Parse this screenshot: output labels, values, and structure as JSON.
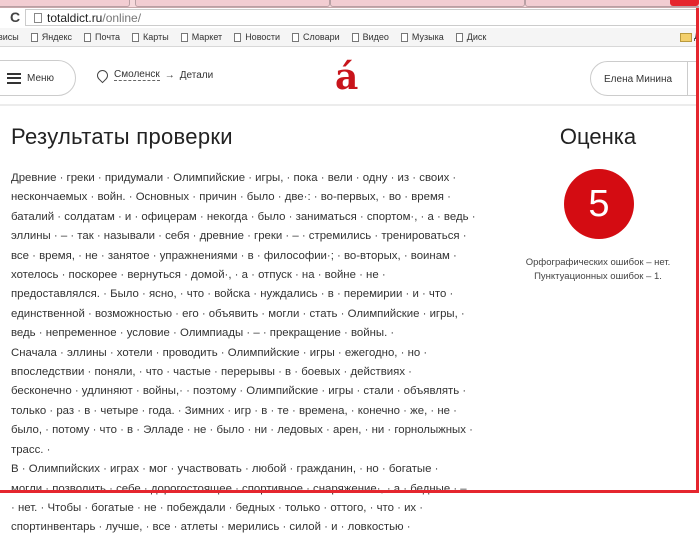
{
  "browser": {
    "url_host": "totaldict.ru",
    "url_path": "/online/",
    "bookmarks": [
      "висы",
      "Яндекс",
      "Почта",
      "Карты",
      "Маркет",
      "Новости",
      "Словари",
      "Видео",
      "Музыка",
      "Диск"
    ],
    "bookmark_folder": "Д"
  },
  "header": {
    "menu_label": "Меню",
    "city": "Смоленск",
    "arrow": "→",
    "section": "Детали",
    "logo": "á",
    "user": "Елена Минина"
  },
  "main": {
    "title": "Результаты проверки",
    "lines": [
      "Древние · греки · придумали · Олимпийские · игры, · пока · вели · одну · из · своих ·",
      "нескончаемых · войн. · Основных · причин · было · две·: · во-первых, · во · время ·",
      "баталий · солдатам · и · офицерам · некогда · было · заниматься · спортом·, · а · ведь ·",
      "эллины · – · так · называли · себя · древние · греки · – · стремились · тренироваться ·",
      "все · время, · не · занятое · упражнениями · в · философии·; · во-вторых, · воинам ·",
      "хотелось · поскорее · вернуться · домой·, · а · отпуск · на · войне · не ·",
      "предоставлялся. · Было · ясно, · что · войска · нуждались · в · перемирии · и · что ·",
      "единственной · возможностью · его · объявить · могли · стать · Олимпийские · игры, ·",
      "ведь · непременное · условие · Олимпиады · – · прекращение · войны. ·",
      "Сначала · эллины · хотели · проводить · Олимпийские · игры · ежегодно, · но ·",
      "впоследствии · поняли, · что · частые · перерывы · в · боевых · действиях ·",
      "бесконечно · удлиняют · войны,· · поэтому · Олимпийские · игры · стали · объявлять ·",
      "только · раз · в · четыре · года. · Зимних · игр · в · те · времена, · конечно · же, · не ·",
      "было, · потому · что · в · Элладе · не · было · ни · ледовых · арен, · ни · горнолыжных ·",
      "трасс. ·",
      "В · Олимпийских · играх · мог · участвовать · любой · гражданин, · но · богатые ·",
      "могли · позволить · себе · дорогостоящее · спортивное · снаряжение·, · а · бедные · –",
      "· нет. · Чтобы · богатые · не · побеждали · бедных · только · оттого, · что · их ·",
      "спортинвентарь · лучше, · все · атлеты · мерились · силой · и · ловкостью ·"
    ]
  },
  "grade": {
    "title": "Оценка",
    "value": "5",
    "spelling": "Орфографических ошибок – нет.",
    "punctuation": "Пунктуационных ошибок – 1.",
    "color": "#d40c12"
  }
}
